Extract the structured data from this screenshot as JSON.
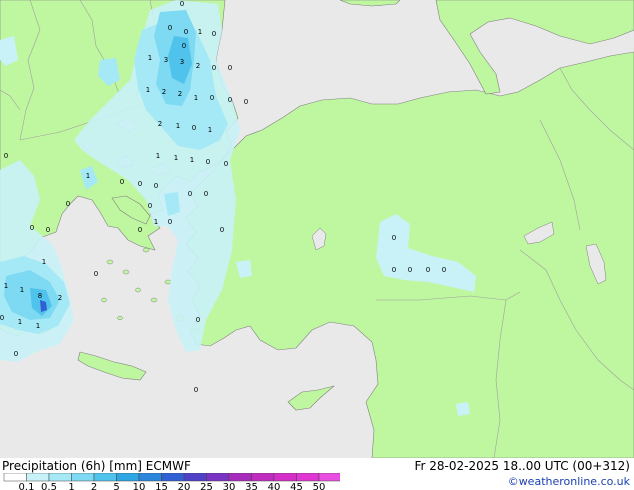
{
  "footer": {
    "title": "Precipitation (6h) [mm] ECMWF",
    "valid_time": "Fr 28-02-2025 18..00 UTC (00+312)",
    "credit": "©weatheronline.co.uk"
  },
  "legend": {
    "labels": [
      "0.1",
      "0.5",
      "1",
      "2",
      "5",
      "10",
      "15",
      "20",
      "25",
      "30",
      "35",
      "40",
      "45",
      "50"
    ],
    "colors": [
      "#ffffff",
      "#c8f2f8",
      "#a6e9f6",
      "#7ed9f2",
      "#50c3ec",
      "#2da6e3",
      "#2c87dc",
      "#3060d4",
      "#5040c8",
      "#7a33c2",
      "#a62cbd",
      "#c02cc0",
      "#d42ec8",
      "#e036d2",
      "#e84ee0"
    ]
  },
  "colors": {
    "land": "#bff6a0",
    "sea": "#e9e9e9",
    "coast": "#808080",
    "border": "#a0a0a0"
  },
  "map_labels": [
    {
      "t": "0"
    },
    {
      "t": "0"
    },
    {
      "t": "0"
    },
    {
      "t": "1"
    },
    {
      "t": "0"
    },
    {
      "t": "0"
    },
    {
      "t": "1"
    },
    {
      "t": "3"
    },
    {
      "t": "3"
    },
    {
      "t": "2"
    },
    {
      "t": "0"
    },
    {
      "t": "0"
    },
    {
      "t": "1"
    },
    {
      "t": "2"
    },
    {
      "t": "2"
    },
    {
      "t": "1"
    },
    {
      "t": "0"
    },
    {
      "t": "0"
    },
    {
      "t": "0"
    },
    {
      "t": "2"
    },
    {
      "t": "1"
    },
    {
      "t": "0"
    },
    {
      "t": "1"
    },
    {
      "t": "1"
    },
    {
      "t": "1"
    },
    {
      "t": "1"
    },
    {
      "t": "0"
    },
    {
      "t": "0"
    },
    {
      "t": "0"
    },
    {
      "t": "1"
    },
    {
      "t": "0"
    },
    {
      "t": "0"
    },
    {
      "t": "0"
    },
    {
      "t": "0"
    },
    {
      "t": "0"
    },
    {
      "t": "0"
    },
    {
      "t": "0"
    },
    {
      "t": "1"
    },
    {
      "t": "0"
    },
    {
      "t": "0"
    },
    {
      "t": "0"
    },
    {
      "t": "0"
    },
    {
      "t": "1"
    },
    {
      "t": "0"
    },
    {
      "t": "1"
    },
    {
      "t": "1"
    },
    {
      "t": "8"
    },
    {
      "t": "2"
    },
    {
      "t": "0"
    },
    {
      "t": "1"
    },
    {
      "t": "1"
    },
    {
      "t": "0"
    },
    {
      "t": "0"
    },
    {
      "t": "0"
    },
    {
      "t": "0"
    },
    {
      "t": "0"
    },
    {
      "t": "0"
    },
    {
      "t": "0"
    },
    {
      "t": "0"
    },
    {
      "t": "0"
    }
  ]
}
